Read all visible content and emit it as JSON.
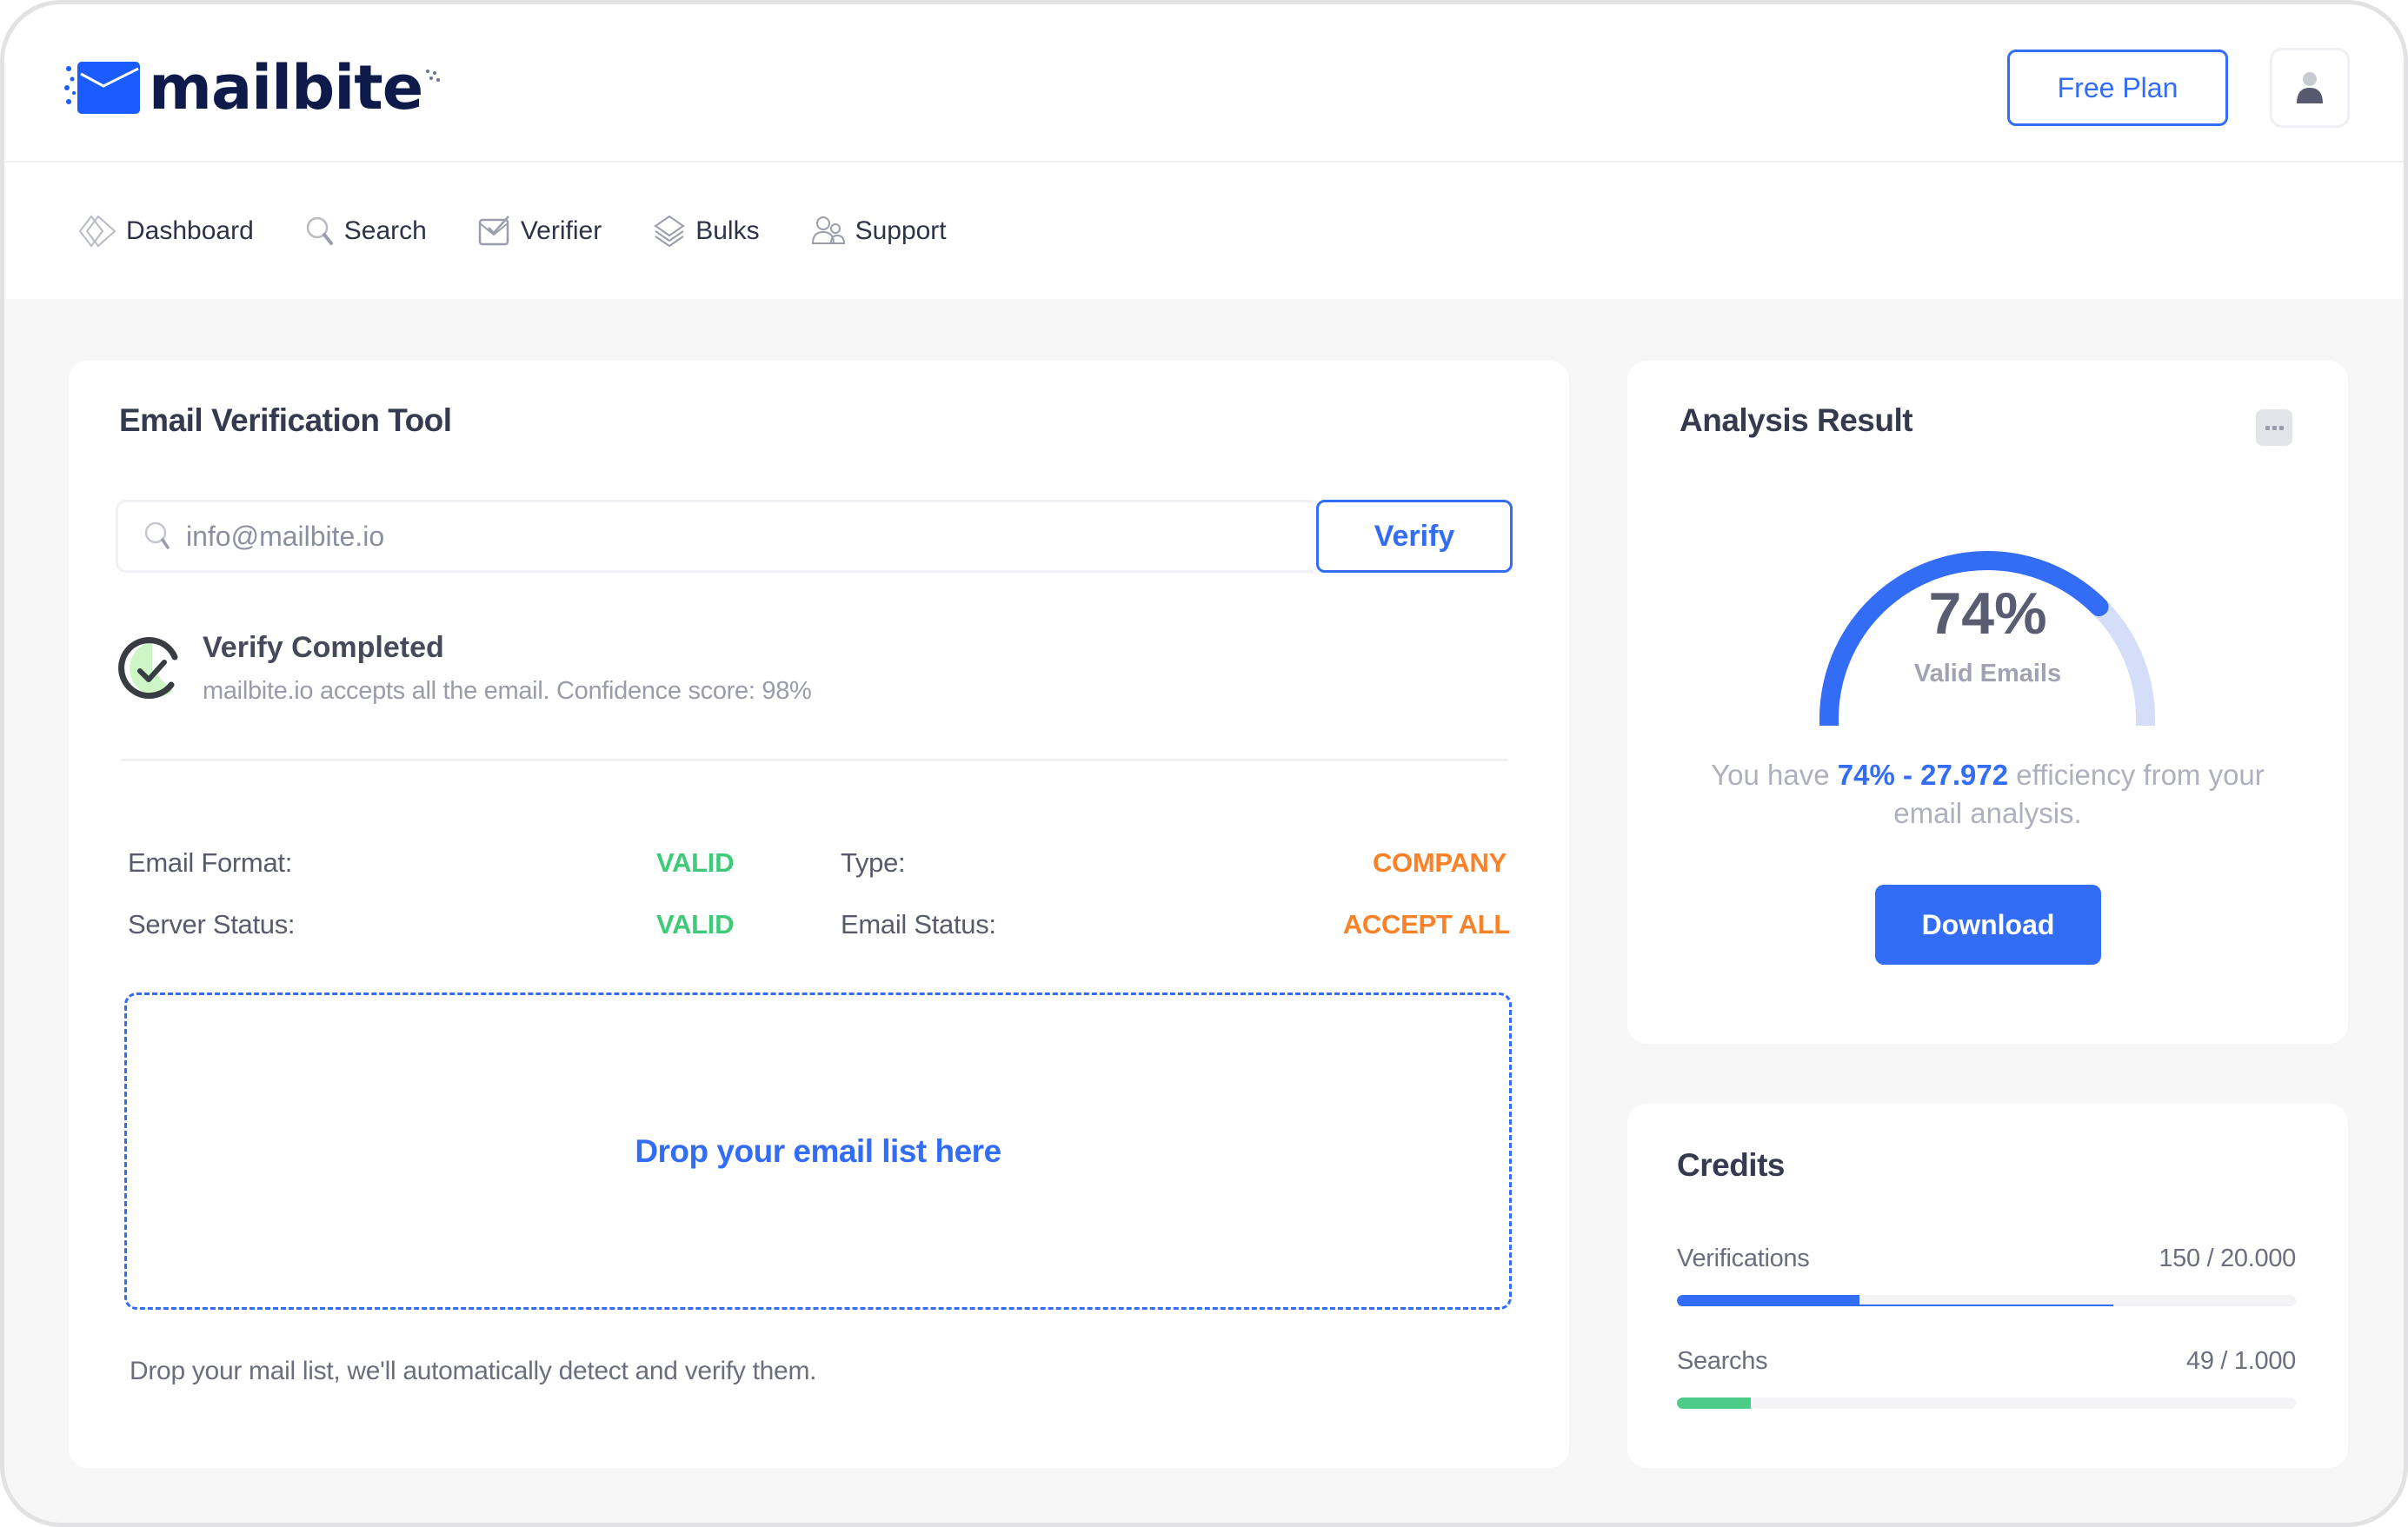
{
  "app": {
    "brand": "mailbite",
    "colors": {
      "accent": "#336cf5",
      "valid": "#3ecb79",
      "warning": "#f98228",
      "logo_text": "#0d1a4a"
    }
  },
  "header": {
    "plan_button": "Free Plan",
    "avatar_icon": "user-icon"
  },
  "nav": {
    "items": [
      {
        "label": "Dashboard",
        "icon": "dashboard-icon"
      },
      {
        "label": "Search",
        "icon": "search-icon"
      },
      {
        "label": "Verifier",
        "icon": "verifier-icon"
      },
      {
        "label": "Bulks",
        "icon": "layers-icon"
      },
      {
        "label": "Support",
        "icon": "users-icon"
      }
    ]
  },
  "verification_tool": {
    "title": "Email Verification Tool",
    "input_value": "info@mailbite.io",
    "input_placeholder": "info@mailbite.io",
    "verify_button": "Verify",
    "status_title": "Verify Completed",
    "status_message": "mailbite.io accepts all the email. Confidence score: 98%",
    "results": [
      {
        "label": "Email Format:",
        "value": "VALID",
        "tone": "green"
      },
      {
        "label": "Type:",
        "value": "COMPANY",
        "tone": "orange"
      },
      {
        "label": "Server Status:",
        "value": "VALID",
        "tone": "green"
      },
      {
        "label": "Email Status:",
        "value": "ACCEPT ALL",
        "tone": "orange"
      }
    ],
    "dropzone_text": "Drop your email list here",
    "dropzone_hint": "Drop your mail list, we'll automatically detect and verify them."
  },
  "analysis": {
    "title": "Analysis Result",
    "more_icon": "more-icon",
    "gauge_percent": 74,
    "gauge_value_text": "74%",
    "gauge_label": "Valid Emails",
    "efficiency_prefix": "You have ",
    "efficiency_highlight": "74% - 27.972",
    "efficiency_suffix": " efficiency from your email analysis.",
    "download_button": "Download"
  },
  "credits": {
    "title": "Credits",
    "items": [
      {
        "label": "Verifications",
        "value": "150 / 20.000",
        "fill_fraction": 0.295,
        "color": "#336cf5"
      },
      {
        "label": "Searchs",
        "value": "49 / 1.000",
        "fill_fraction": 0.12,
        "color": "#4ccd87"
      }
    ]
  }
}
